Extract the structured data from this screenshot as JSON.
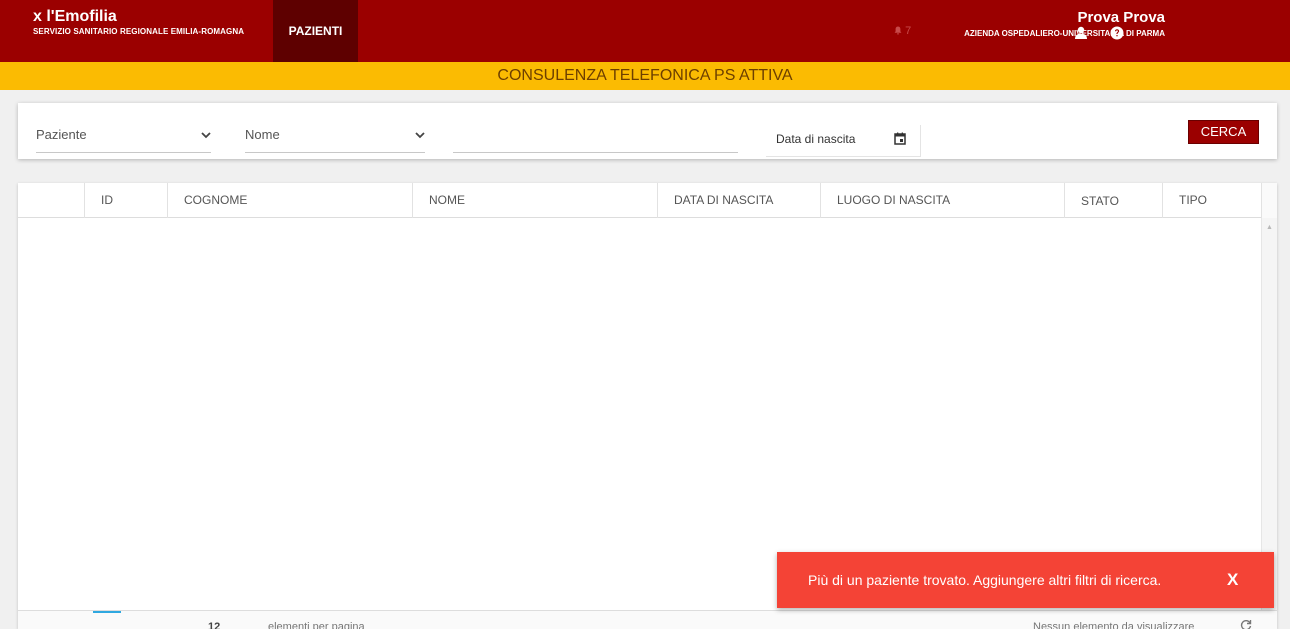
{
  "header": {
    "brand_title": "x l'Emofilia",
    "brand_subtitle": "SERVIZIO SANITARIO REGIONALE EMILIA-ROMAGNA",
    "nav_pazienti": "PAZIENTI",
    "notification_count": "7",
    "user_name": "Prova Prova",
    "user_org": "AZIENDA OSPEDALIERO-UNIVERSITARIA DI PARMA",
    "icons": [
      "bell-icon",
      "user-icon",
      "help-icon"
    ]
  },
  "banner": {
    "text": "CONSULENZA TELEFONICA PS ATTIVA"
  },
  "filters": {
    "paziente_select": "Paziente",
    "nome_select": "Nome",
    "search_value": "",
    "date_label": "Data di nascita",
    "search_button": "CERCA"
  },
  "table": {
    "columns": [
      "ID",
      "COGNOME",
      "NOME",
      "DATA DI NASCITA",
      "LUOGO DI NASCITA",
      "STATO",
      "TIPO"
    ],
    "rows": []
  },
  "footer": {
    "page_size": "12",
    "page_text": "elementi per pagina",
    "status_text": "Nessun elemento da visualizzare"
  },
  "toast": {
    "message": "Più di un paziente trovato. Aggiungere altri filtri di ricerca.",
    "close_label": "X"
  },
  "colors": {
    "header_bg": "#9b0000",
    "nav_active_bg": "#5e0000",
    "banner_bg": "#fbbb02",
    "toast_bg": "#f44336",
    "pager_accent": "#2fa8e0"
  }
}
